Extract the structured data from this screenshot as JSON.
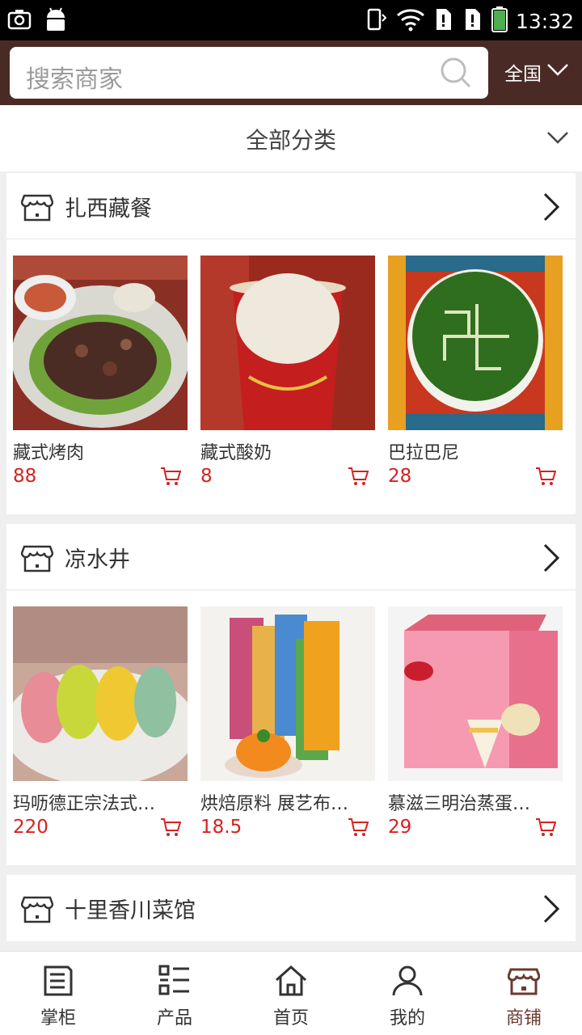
{
  "status_bar": {
    "time": "13:32"
  },
  "header": {
    "search_placeholder": "搜索商家",
    "region": "全国"
  },
  "category": {
    "label": "全部分类"
  },
  "shops": [
    {
      "name": "扎西藏餐",
      "products": [
        {
          "name": "藏式烤肉",
          "price": "88"
        },
        {
          "name": "藏式酸奶",
          "price": "8"
        },
        {
          "name": "巴拉巴尼",
          "price": "28"
        }
      ]
    },
    {
      "name": "凉水井",
      "products": [
        {
          "name": "玛呖德正宗法式…",
          "price": "220"
        },
        {
          "name": "烘焙原料 展艺布…",
          "price": "18.5"
        },
        {
          "name": "慕滋三明治蒸蛋…",
          "price": "29"
        }
      ]
    },
    {
      "name": "十里香川菜馆"
    }
  ],
  "bottom_nav": [
    {
      "label": "掌柜",
      "icon": "document-icon"
    },
    {
      "label": "产品",
      "icon": "list-icon"
    },
    {
      "label": "首页",
      "icon": "home-icon"
    },
    {
      "label": "我的",
      "icon": "user-icon"
    },
    {
      "label": "商铺",
      "icon": "store-icon",
      "active": true
    }
  ],
  "colors": {
    "header_bg": "#4a2a25",
    "price": "#d62020",
    "active_tab": "#6b3a2f"
  }
}
